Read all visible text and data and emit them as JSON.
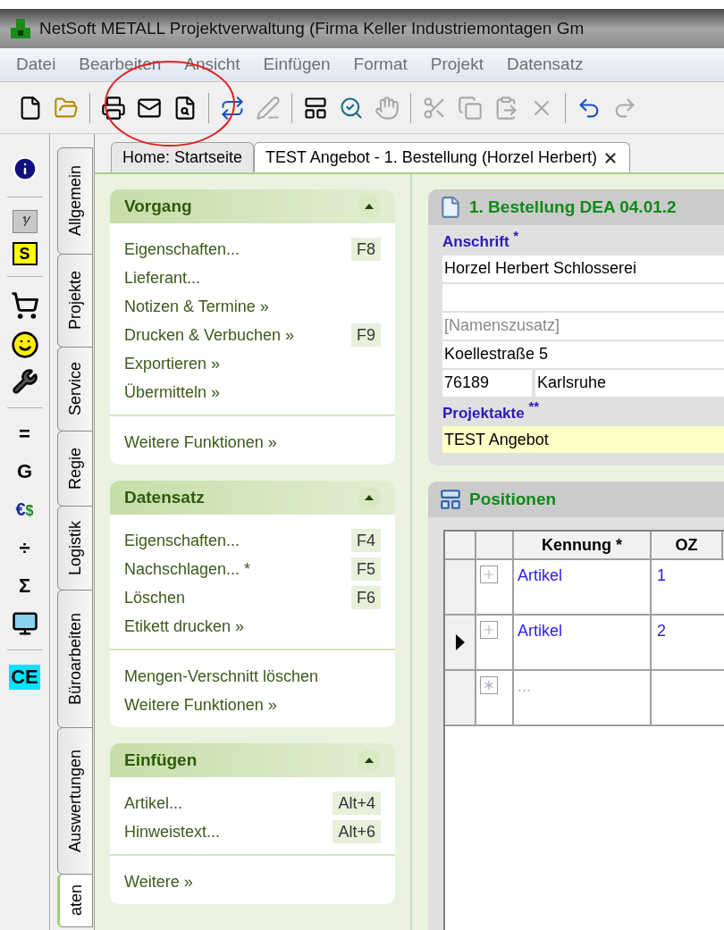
{
  "window": {
    "title": "NetSoft METALL Projektverwaltung (Firma Keller Industriemontagen Gm"
  },
  "menu": [
    "Datei",
    "Bearbeiten",
    "Ansicht",
    "Einfügen",
    "Format",
    "Projekt",
    "Datensatz"
  ],
  "toolbar": [
    {
      "kind": "new",
      "disabled": false
    },
    {
      "kind": "open",
      "disabled": false
    },
    {
      "kind": "separator"
    },
    {
      "kind": "print",
      "disabled": false
    },
    {
      "kind": "attach",
      "disabled": false
    },
    {
      "kind": "preview",
      "disabled": false
    },
    {
      "kind": "separator"
    },
    {
      "kind": "refresh",
      "disabled": false
    },
    {
      "kind": "edit",
      "disabled": true
    },
    {
      "kind": "separator"
    },
    {
      "kind": "layout",
      "disabled": false
    },
    {
      "kind": "zoom",
      "disabled": false
    },
    {
      "kind": "hand",
      "disabled": true
    },
    {
      "kind": "separator"
    },
    {
      "kind": "cut",
      "disabled": true
    },
    {
      "kind": "copy",
      "disabled": true
    },
    {
      "kind": "paste",
      "disabled": true
    },
    {
      "kind": "delete",
      "disabled": true
    },
    {
      "kind": "separator"
    },
    {
      "kind": "undo",
      "disabled": false
    },
    {
      "kind": "redo",
      "disabled": true
    }
  ],
  "quick_bar": [
    {
      "kind": "info"
    },
    {
      "kind": "separator"
    },
    {
      "kind": "boxed",
      "glyph": "⅟"
    },
    {
      "kind": "tag",
      "glyph": "S"
    },
    {
      "kind": "separator"
    },
    {
      "kind": "cart"
    },
    {
      "kind": "smiley"
    },
    {
      "kind": "wrench"
    },
    {
      "kind": "separator"
    },
    {
      "kind": "glyph",
      "glyph": "="
    },
    {
      "kind": "glyph",
      "glyph": "G"
    },
    {
      "kind": "currency",
      "glyph": "€",
      "glyph2": "$"
    },
    {
      "kind": "glyph",
      "glyph": "÷"
    },
    {
      "kind": "glyph",
      "glyph": "Σ"
    },
    {
      "kind": "transfer"
    },
    {
      "kind": "separator"
    },
    {
      "kind": "ce",
      "glyph": "CE"
    }
  ],
  "side_tabs": [
    {
      "label": "Allgemein",
      "selected": false
    },
    {
      "label": "Projekte",
      "selected": false
    },
    {
      "label": "Service",
      "selected": false
    },
    {
      "label": "Regie",
      "selected": false
    },
    {
      "label": "Logistik",
      "selected": false
    },
    {
      "label": "Büroarbeiten",
      "selected": false
    },
    {
      "label": "Auswertungen",
      "selected": false
    },
    {
      "label": "aten",
      "selected": true
    }
  ],
  "doc_tabs": [
    {
      "label": "Home: Startseite",
      "selected": false,
      "closable": false
    },
    {
      "label": "TEST Angebot - 1. Bestellung (Horzel Herbert)",
      "selected": true,
      "closable": true
    }
  ],
  "task_sections": [
    {
      "title": "Vorgang",
      "expanded": true,
      "groups": [
        [
          {
            "label": "Eigenschaften...",
            "shortcut": "F8"
          },
          {
            "label": "Lieferant..."
          },
          {
            "label": "Notizen & Termine »"
          },
          {
            "label": "Drucken & Verbuchen »",
            "shortcut": "F9"
          },
          {
            "label": "Exportieren »"
          },
          {
            "label": "Übermitteln »"
          }
        ],
        [
          {
            "label": "Weitere Funktionen »"
          }
        ]
      ]
    },
    {
      "title": "Datensatz",
      "expanded": true,
      "groups": [
        [
          {
            "label": "Eigenschaften...",
            "shortcut": "F4"
          },
          {
            "label": "Nachschlagen... *",
            "shortcut": "F5"
          },
          {
            "label": "Löschen",
            "shortcut": "F6"
          },
          {
            "label": "Etikett drucken »"
          }
        ],
        [
          {
            "label": "Mengen-Verschnitt löschen"
          },
          {
            "label": "Weitere Funktionen »"
          }
        ]
      ]
    },
    {
      "title": "Einfügen",
      "expanded": true,
      "groups": [
        [
          {
            "label": "Artikel...",
            "shortcut": "Alt+4"
          },
          {
            "label": "Hinweistext...",
            "shortcut": "Alt+6"
          }
        ],
        [
          {
            "label": "Weitere »"
          }
        ]
      ]
    }
  ],
  "record": {
    "title": "1. Bestellung DEA 04.01.2",
    "address_label": "Anschrift",
    "address_mark": "*",
    "name": "Horzel Herbert Schlosserei",
    "name_suffix": {
      "placeholder": "[Namenszusatz]"
    },
    "street": "Koellestraße 5",
    "zip": "76189",
    "city": "Karlsruhe",
    "file_label": "Projektakte",
    "file_mark": "**",
    "file": "TEST Angebot"
  },
  "positions": {
    "title": "Positionen",
    "columns": [
      "Kennung *",
      "OZ"
    ],
    "rows": [
      {
        "kind": "item",
        "current": false,
        "kennung": "Artikel",
        "oz": "1"
      },
      {
        "kind": "item",
        "current": true,
        "kennung": "Artikel",
        "oz": "2"
      },
      {
        "kind": "new",
        "current": false,
        "kennung": "..."
      }
    ]
  }
}
